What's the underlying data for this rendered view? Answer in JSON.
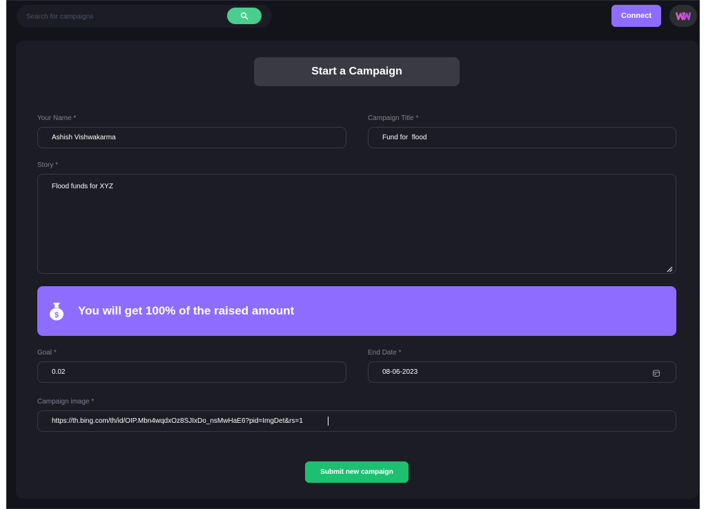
{
  "header": {
    "search": {
      "placeholder": "Search for campaigns",
      "value": ""
    },
    "connect_label": "Connect"
  },
  "form": {
    "title": "Start a Campaign",
    "name": {
      "label": "Your Name *",
      "value": "Ashish Vishwakarma"
    },
    "campaign_title": {
      "label": "Campaign Title *",
      "value": "Fund for  flood"
    },
    "story": {
      "label": "Story *",
      "value": "Flood funds for XYZ"
    },
    "banner_text": "You will get 100% of the raised amount",
    "goal": {
      "label": "Goal *",
      "value": "0.02"
    },
    "end_date": {
      "label": "End Date *",
      "value": "08-06-2023"
    },
    "image": {
      "label": "Campaign image *",
      "value": "https://th.bing.com/th/id/OIP.Mbn4wqdxOz8SJIxDo_nsMwHaE6?pid=ImgDet&rs=1"
    },
    "submit_label": "Submit new campaign"
  },
  "colors": {
    "background": "#13131a",
    "card": "#1c1c24",
    "accent_purple": "#8c6dfd",
    "accent_green": "#1dc071",
    "search_green": "#4acd8d",
    "label_gray": "#808191"
  },
  "icons": {
    "search": "search-icon",
    "avatar": "brand-logo-icon",
    "banner": "money-bag-icon",
    "date": "calendar-icon"
  }
}
